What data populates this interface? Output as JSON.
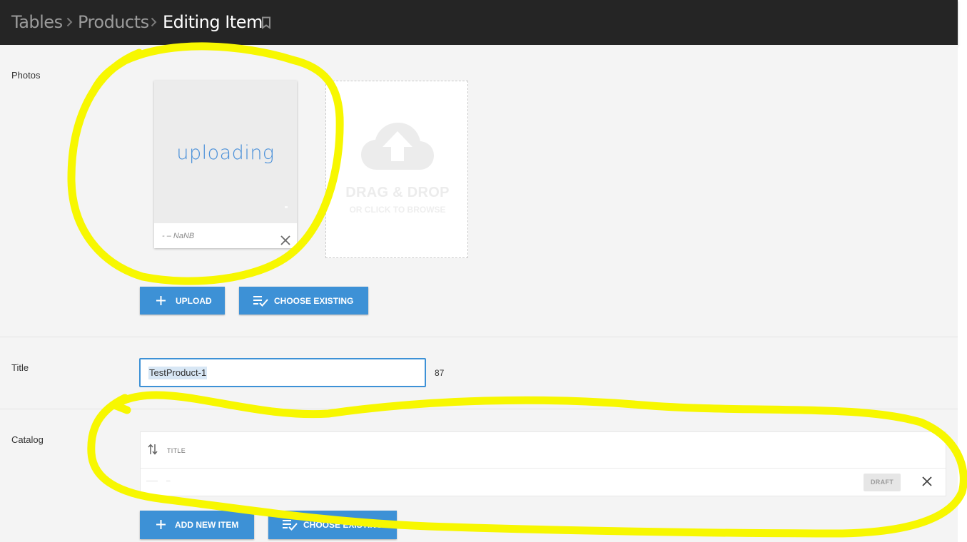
{
  "breadcrumb": {
    "items": [
      "Tables",
      "Products"
    ],
    "current": "Editing Item"
  },
  "photos": {
    "label": "Photos",
    "item": {
      "status_text": "uploading",
      "meta": "- – NaNB"
    },
    "dropzone": {
      "title": "DRAG & DROP",
      "subtitle": "OR CLICK TO BROWSE"
    },
    "upload_button": "UPLOAD",
    "choose_existing_button": "CHOOSE EXISTING"
  },
  "title_field": {
    "label": "Title",
    "value": "TestProduct-1",
    "char_count": "87"
  },
  "catalog": {
    "label": "Catalog",
    "column_header": "TITLE",
    "rows": [
      {
        "title": "–",
        "status": "DRAFT"
      }
    ],
    "add_button": "ADD NEW ITEM",
    "choose_existing_button": "CHOOSE EXISTING"
  },
  "colors": {
    "header_bg": "#252525",
    "accent": "#3d91d6",
    "annotation": "#f7f700"
  },
  "icons": {
    "separator": "chevron-right-icon",
    "bookmark": "bookmark-icon",
    "remove": "close-icon",
    "cloud": "cloud-upload-icon",
    "add": "plus-icon",
    "choose": "playlist-check-icon",
    "sort": "sort-icon"
  }
}
